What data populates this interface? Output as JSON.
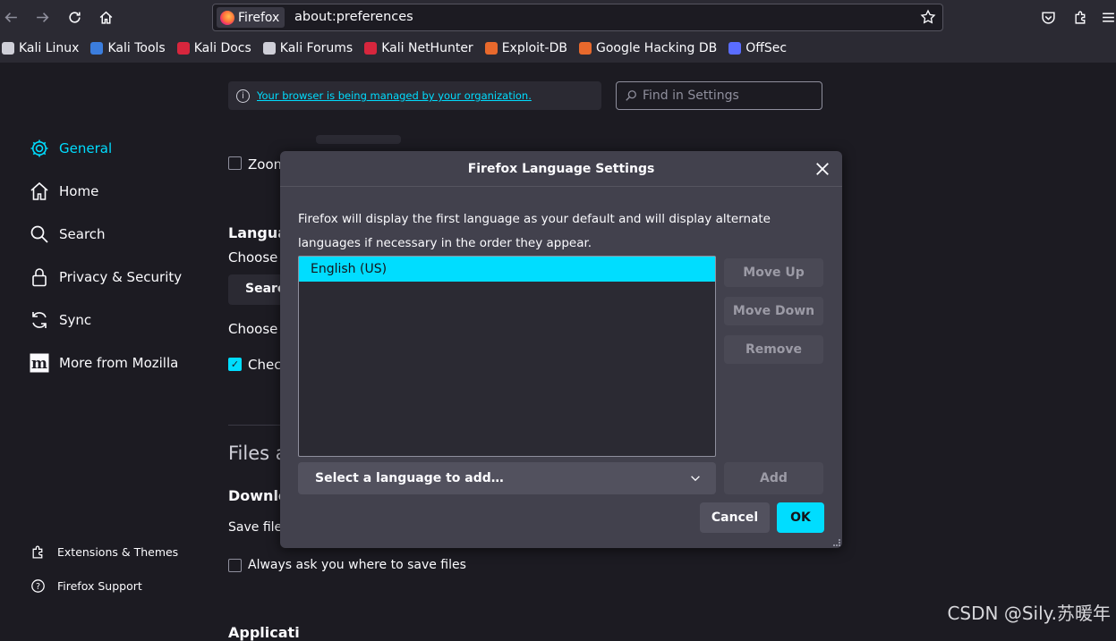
{
  "browser": {
    "identity_label": "Firefox",
    "url": "about:preferences"
  },
  "bookmarks": [
    {
      "label": "Kali Linux",
      "icon": "kali-dragon-icon",
      "color": "#cfcfd8"
    },
    {
      "label": "Kali Tools",
      "icon": "kali-tools-icon",
      "color": "#3b7ddd"
    },
    {
      "label": "Kali Docs",
      "icon": "kali-docs-icon",
      "color": "#d7263d"
    },
    {
      "label": "Kali Forums",
      "icon": "kali-forums-icon",
      "color": "#cfcfd8"
    },
    {
      "label": "Kali NetHunter",
      "icon": "nethunter-icon",
      "color": "#d7263d"
    },
    {
      "label": "Exploit-DB",
      "icon": "exploit-db-icon",
      "color": "#e8692c"
    },
    {
      "label": "Google Hacking DB",
      "icon": "ghdb-icon",
      "color": "#e8692c"
    },
    {
      "label": "OffSec",
      "icon": "offsec-icon",
      "color": "#5a6dff"
    }
  ],
  "prefs": {
    "notice_link": "Your browser is being managed by your organization.",
    "find_placeholder": "Find in Settings",
    "categories": [
      {
        "label": "General"
      },
      {
        "label": "Home"
      },
      {
        "label": "Search"
      },
      {
        "label": "Privacy & Security"
      },
      {
        "label": "Sync"
      },
      {
        "label": "More from Mozilla"
      }
    ],
    "footer_links": [
      {
        "label": "Extensions & Themes"
      },
      {
        "label": "Firefox Support"
      }
    ],
    "bg_text": {
      "zoom": "Zoom",
      "language_heading": "Langua",
      "choose_1": "Choose t",
      "search_btn": "Searc",
      "choose_2": "Choose y",
      "check": "Check",
      "files_heading": "Files a",
      "downloads_heading": "Downlo",
      "save_files": "Save files",
      "always_ask": "Always ask you where to save files",
      "applications": "Applicati"
    }
  },
  "dialog": {
    "title": "Firefox Language Settings",
    "description": "Firefox will display the first language as your default and will display alternate languages if necessary in the order they appear.",
    "languages": [
      "English (US)"
    ],
    "move_up": "Move Up",
    "move_down": "Move Down",
    "remove": "Remove",
    "select_placeholder": "Select a language to add…",
    "add": "Add",
    "cancel": "Cancel",
    "ok": "OK"
  },
  "watermark": "CSDN @Sily.苏暖年"
}
